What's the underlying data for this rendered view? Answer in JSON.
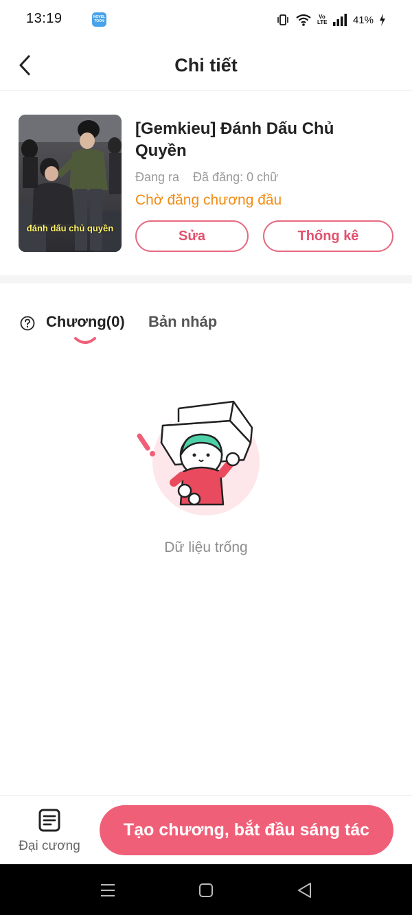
{
  "status_bar": {
    "time": "13:19",
    "app_notification_icon": "novel-toon-app-icon",
    "app_notification_text": "NOVEL TOON",
    "volte_text": "Vo LTE",
    "battery_percent": "41%"
  },
  "header": {
    "title": "Chi tiết",
    "back_icon": "chevron-left-icon"
  },
  "book": {
    "cover_caption": "đánh dấu chủ quyền",
    "title": "[Gemkieu] Đánh Dấu Chủ Quyền",
    "status": "Đang ra",
    "published": "Đã đăng: 0 chữ",
    "pending_text": "Chờ đăng chương đầu",
    "edit_label": "Sửa",
    "stats_label": "Thống kê"
  },
  "tabs": {
    "help_icon": "question-circle-icon",
    "chapters_label": "Chương(0)",
    "drafts_label": "Bản nháp"
  },
  "empty_state": {
    "text": "Dữ liệu trống"
  },
  "bottom_bar": {
    "outline_label": "Đại cương",
    "create_label": "Tạo chương, bắt đầu sáng tác"
  },
  "colors": {
    "accent": "#f05f78",
    "pending": "#f08c14",
    "outline_border": "#e66a80"
  }
}
